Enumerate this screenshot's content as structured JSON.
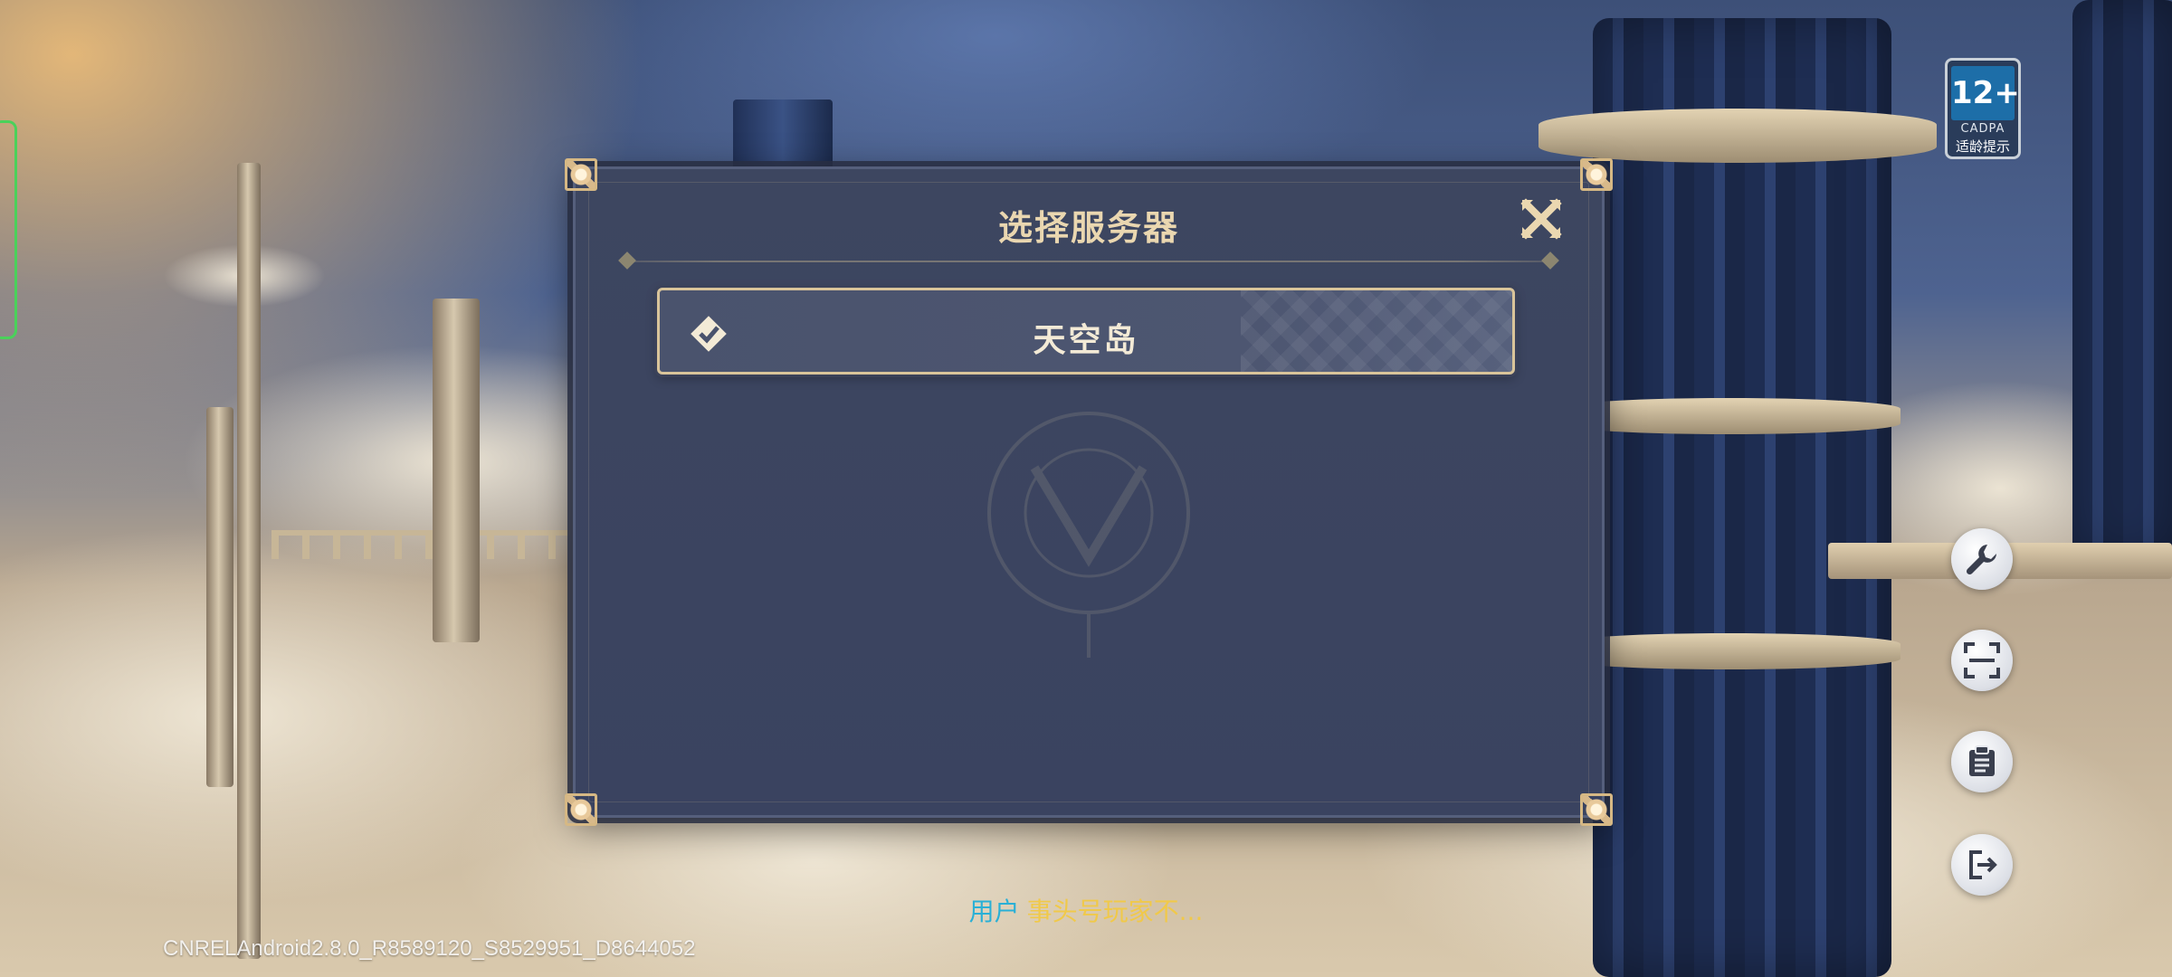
{
  "dialog": {
    "title": "选择服务器",
    "close_icon": "close-x-icon",
    "servers": [
      {
        "name": "天空岛",
        "selected": true,
        "icon": "check-diamond-icon"
      }
    ]
  },
  "age_rating": {
    "number": "12+",
    "org": "CADPA",
    "tip": "适龄提示"
  },
  "tools": [
    {
      "name": "repair",
      "icon": "wrench-icon"
    },
    {
      "name": "scan",
      "icon": "scan-icon"
    },
    {
      "name": "notice",
      "icon": "clipboard-icon"
    },
    {
      "name": "logout",
      "icon": "exit-icon"
    }
  ],
  "footer": {
    "user_label": "用户",
    "user_name": "事头号玩家不...",
    "version": "CNRELAndroid2.8.0_R8589120_S8529951_D8644052"
  },
  "colors": {
    "title_gold": "#ead7b0",
    "frame_gold": "#d9c49a",
    "dialog_bg": "#3d4660",
    "user_label": "#2ab0d6",
    "user_name": "#f0c94a",
    "accent_green": "#4ad15a"
  }
}
